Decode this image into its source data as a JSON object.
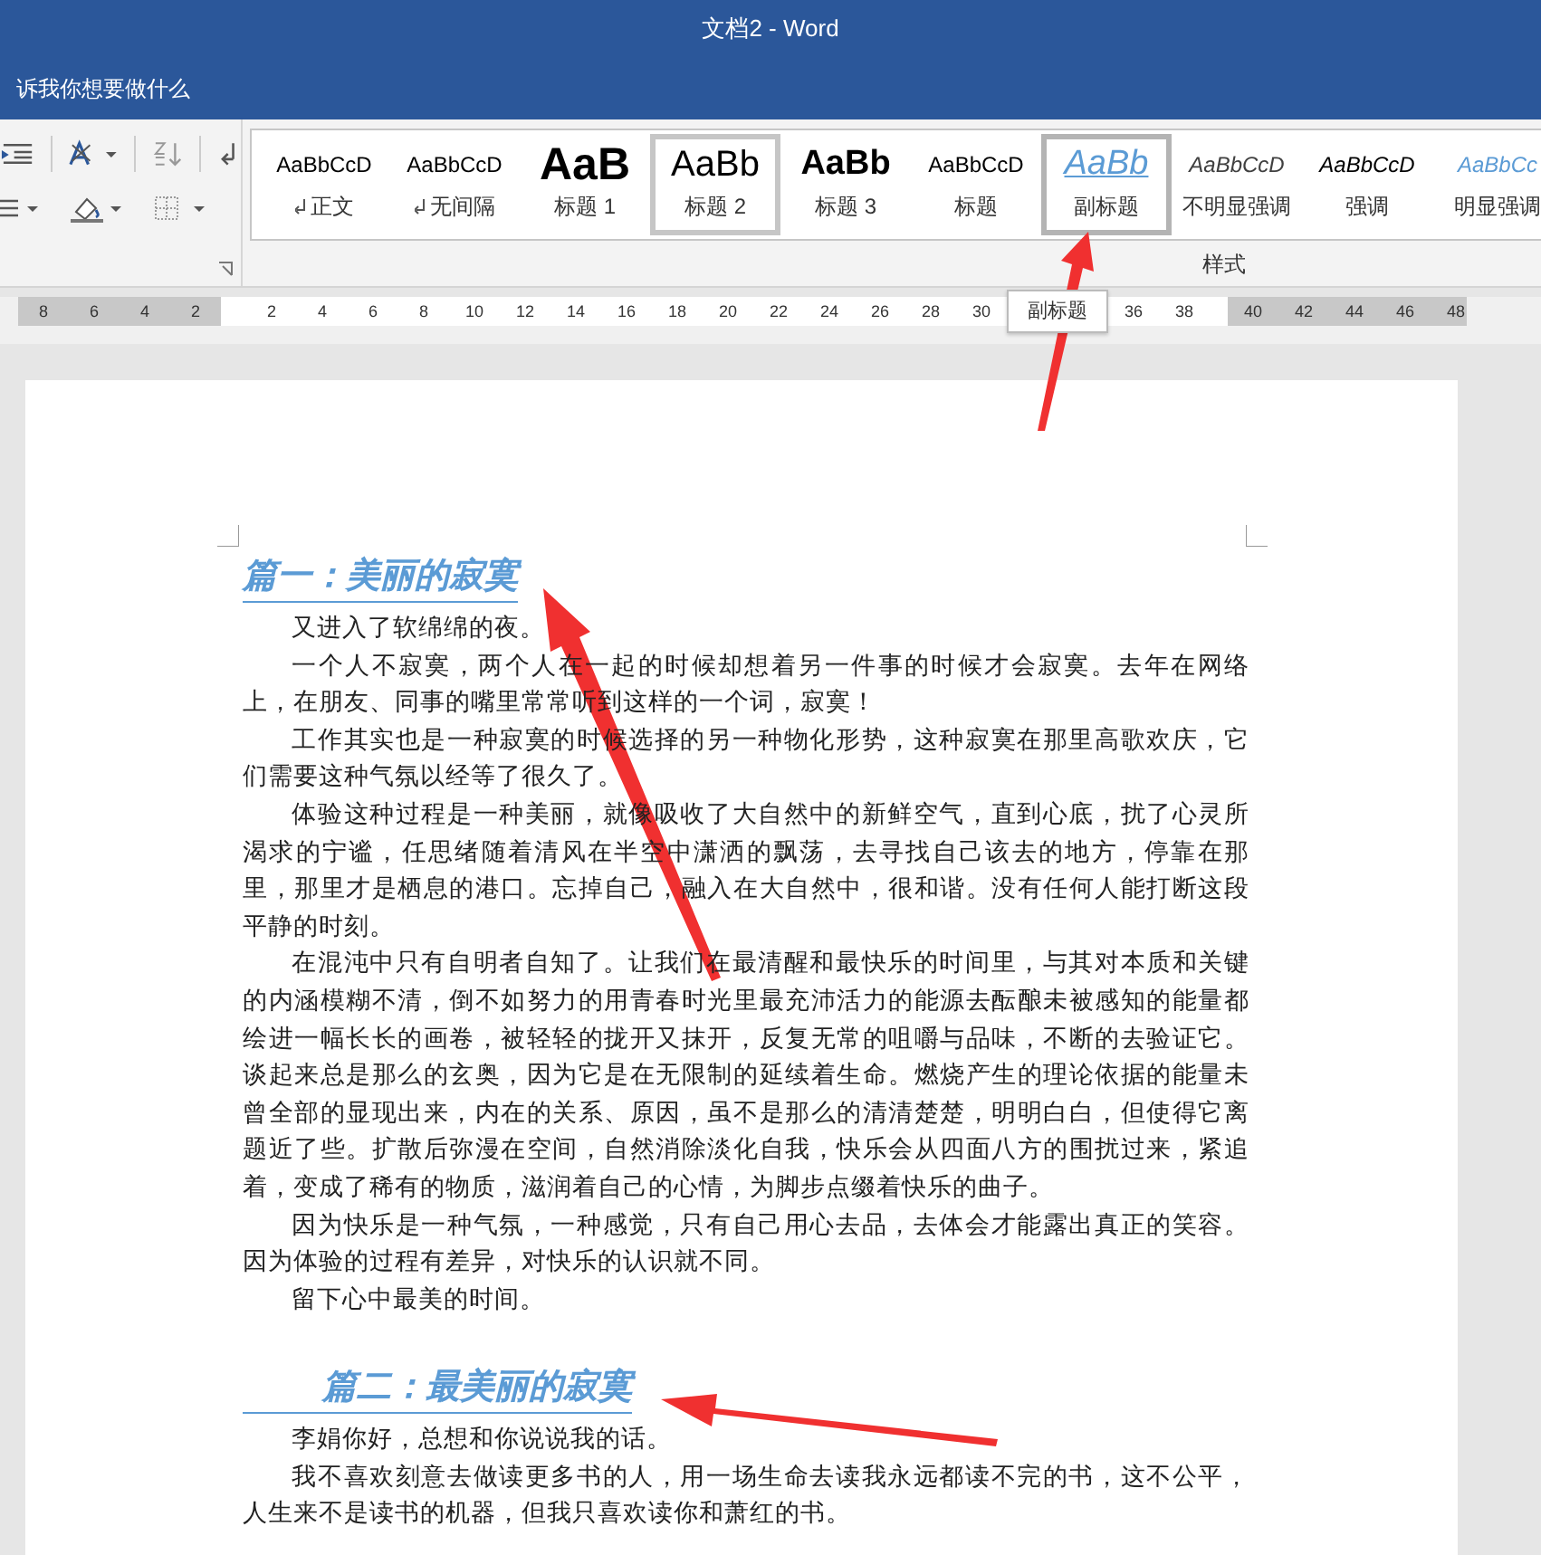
{
  "window": {
    "title": "文档2  -  Word"
  },
  "tell_me": {
    "text": "诉我你想要做什么"
  },
  "ribbon": {
    "styles_group_label": "样式",
    "styles": [
      {
        "preview": "AaBbCcD",
        "label": "正文",
        "kind": "normal",
        "selected": false,
        "hovered": false,
        "mark": true
      },
      {
        "preview": "AaBbCcD",
        "label": "无间隔",
        "kind": "normal",
        "selected": false,
        "hovered": false,
        "mark": true
      },
      {
        "preview": "AaB",
        "label": "标题 1",
        "kind": "heading1",
        "selected": false,
        "hovered": false,
        "mark": false
      },
      {
        "preview": "AaBb",
        "label": "标题 2",
        "kind": "heading2",
        "selected": true,
        "hovered": false,
        "mark": false
      },
      {
        "preview": "AaBb",
        "label": "标题 3",
        "kind": "heading3",
        "selected": false,
        "hovered": false,
        "mark": false
      },
      {
        "preview": "AaBbCcD",
        "label": "标题",
        "kind": "normal",
        "selected": false,
        "hovered": false,
        "mark": false
      },
      {
        "preview": "AaBb",
        "label": "副标题",
        "kind": "subtitle",
        "selected": false,
        "hovered": true,
        "mark": false
      },
      {
        "preview": "AaBbCcD",
        "label": "不明显强调",
        "kind": "subtle",
        "selected": false,
        "hovered": false,
        "mark": false
      },
      {
        "preview": "AaBbCcD",
        "label": "强调",
        "kind": "emphasis",
        "selected": false,
        "hovered": false,
        "mark": false
      },
      {
        "preview": "AaBbCc",
        "label": "明显强调",
        "kind": "intense",
        "selected": false,
        "hovered": false,
        "mark": false
      }
    ]
  },
  "ruler": {
    "left_numbers": [
      "8",
      "6",
      "4",
      "2"
    ],
    "numbers": [
      "2",
      "4",
      "6",
      "8",
      "10",
      "12",
      "14",
      "16",
      "18",
      "20",
      "22",
      "24",
      "26",
      "28",
      "30"
    ],
    "tooltip": "副标题",
    "after_tooltip": [
      "36",
      "38"
    ],
    "right_numbers": [
      "40",
      "42",
      "44",
      "46",
      "48"
    ]
  },
  "document": {
    "blocks": [
      {
        "kind": "heading",
        "text": "篇一：美丽的寂寞",
        "indented": false
      },
      {
        "kind": "paragraph",
        "text": "又进入了软绵绵的夜。"
      },
      {
        "kind": "paragraph",
        "text": "一个人不寂寞，两个人在一起的时候却想着另一件事的时候才会寂寞。去年在网络上，在朋友、同事的嘴里常常听到这样的一个词，寂寞！"
      },
      {
        "kind": "paragraph",
        "text": "工作其实也是一种寂寞的时候选择的另一种物化形势，这种寂寞在那里高歌欢庆，它们需要这种气氛以经等了很久了。"
      },
      {
        "kind": "paragraph",
        "text": "体验这种过程是一种美丽，就像吸收了大自然中的新鲜空气，直到心底，扰了心灵所渴求的宁谧，任思绪随着清风在半空中潇洒的飘荡，去寻找自己该去的地方，停靠在那里，那里才是栖息的港口。忘掉自己，融入在大自然中，很和谐。没有任何人能打断这段平静的时刻。"
      },
      {
        "kind": "paragraph",
        "text": "在混沌中只有自明者自知了。让我们在最清醒和最快乐的时间里，与其对本质和关键的内涵模糊不清，倒不如努力的用青春时光里最充沛活力的能源去酝酿未被感知的能量都绘进一幅长长的画卷，被轻轻的拢开又抹开，反复无常的咀嚼与品味，不断的去验证它。谈起来总是那么的玄奥，因为它是在无限制的延续着生命。燃烧产生的理论依据的能量未曾全部的显现出来，内在的关系、原因，虽不是那么的清清楚楚，明明白白，但使得它离题近了些。扩散后弥漫在空间，自然消除淡化自我，快乐会从四面八方的围扰过来，紧追着，变成了稀有的物质，滋润着自己的心情，为脚步点缀着快乐的曲子。"
      },
      {
        "kind": "paragraph",
        "text": "因为快乐是一种气氛，一种感觉，只有自己用心去品，去体会才能露出真正的笑容。因为体验的过程有差异，对快乐的认识就不同。"
      },
      {
        "kind": "paragraph",
        "text": "留下心中最美的时间。"
      },
      {
        "kind": "heading",
        "text": "篇二：最美丽的寂寞",
        "indented": true
      },
      {
        "kind": "paragraph",
        "text": "李娟你好，总想和你说说我的话。"
      },
      {
        "kind": "paragraph",
        "text": "我不喜欢刻意去做读更多书的人，用一场生命去读我永远都读不完的书，这不公平，人生来不是读书的机器，但我只喜欢读你和萧红的书。"
      }
    ]
  }
}
